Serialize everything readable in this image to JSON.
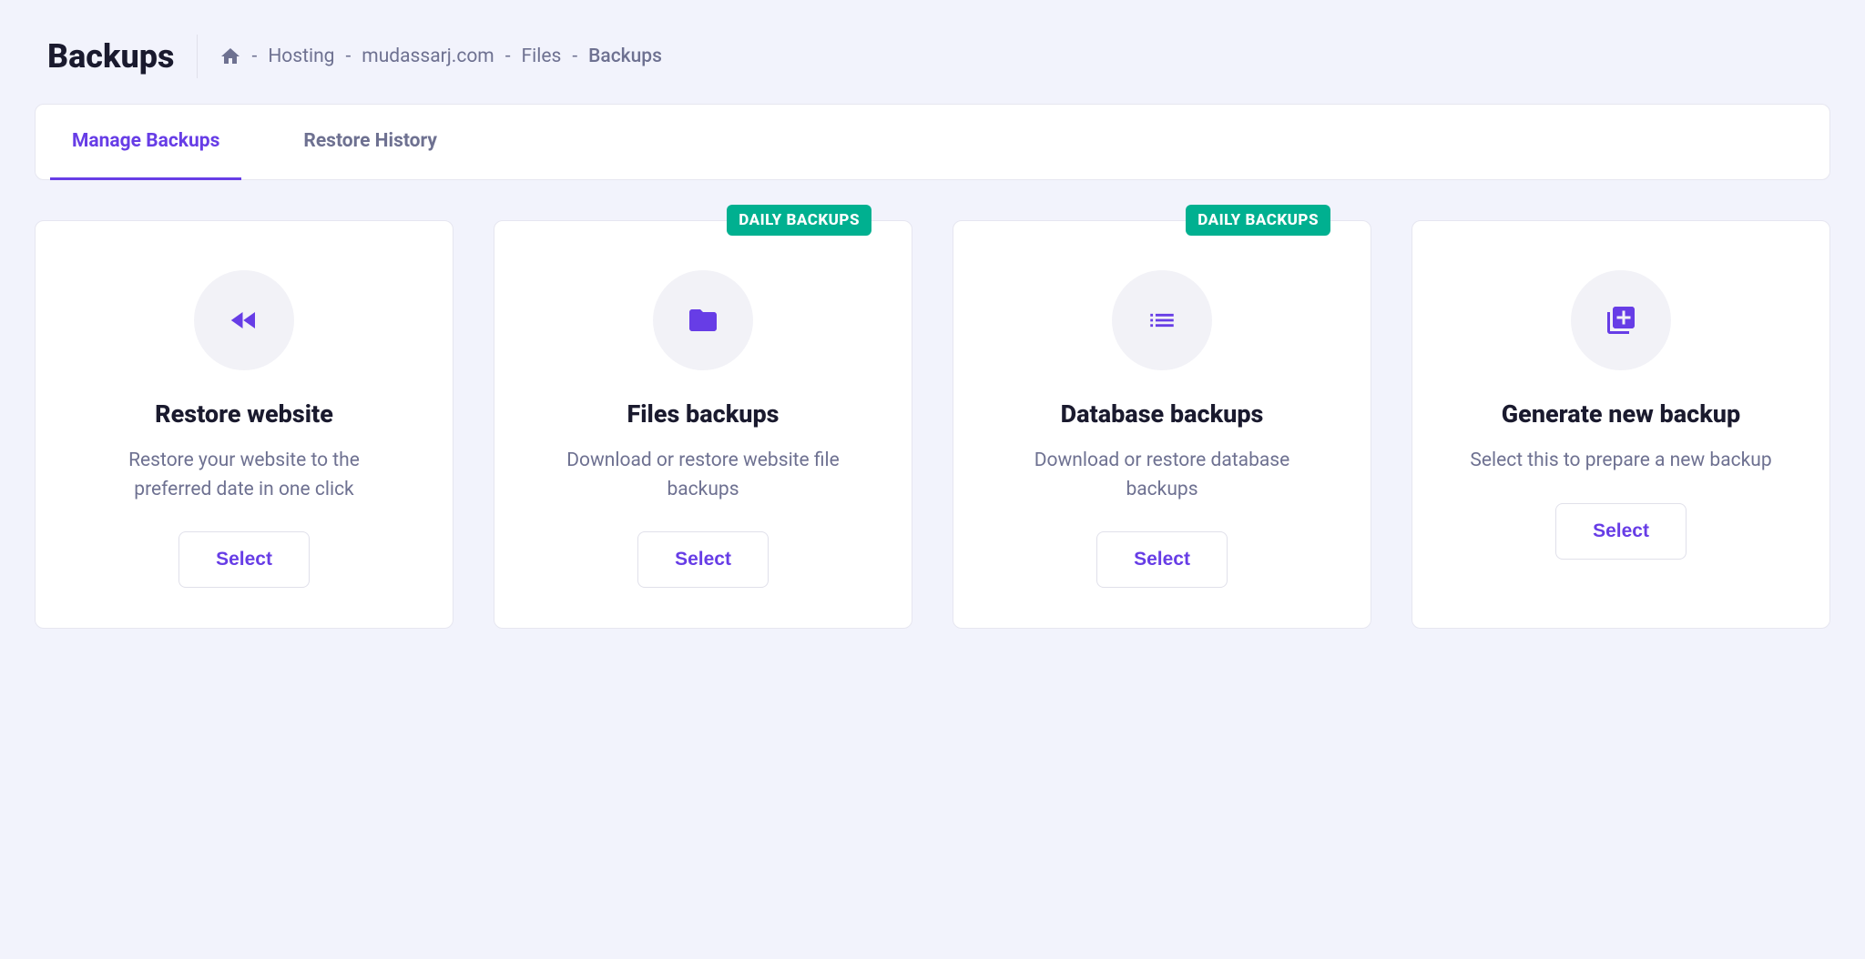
{
  "page": {
    "title": "Backups"
  },
  "breadcrumb": {
    "items": [
      "Hosting",
      "mudassarj.com",
      "Files",
      "Backups"
    ]
  },
  "tabs": [
    {
      "label": "Manage Backups",
      "active": true
    },
    {
      "label": "Restore History",
      "active": false
    }
  ],
  "cards": [
    {
      "icon": "rewind-icon",
      "title": "Restore website",
      "description": "Restore your website to the preferred date in one click",
      "button": "Select",
      "badge": null
    },
    {
      "icon": "folder-icon",
      "title": "Files backups",
      "description": "Download or restore website file backups",
      "button": "Select",
      "badge": "DAILY BACKUPS"
    },
    {
      "icon": "list-icon",
      "title": "Database backups",
      "description": "Download or restore database backups",
      "button": "Select",
      "badge": "DAILY BACKUPS"
    },
    {
      "icon": "add-backup-icon",
      "title": "Generate new backup",
      "description": "Select this to prepare a new backup",
      "button": "Select",
      "badge": null
    }
  ],
  "colors": {
    "accent": "#673de6",
    "badge": "#00b090",
    "textMuted": "#6e7191"
  }
}
